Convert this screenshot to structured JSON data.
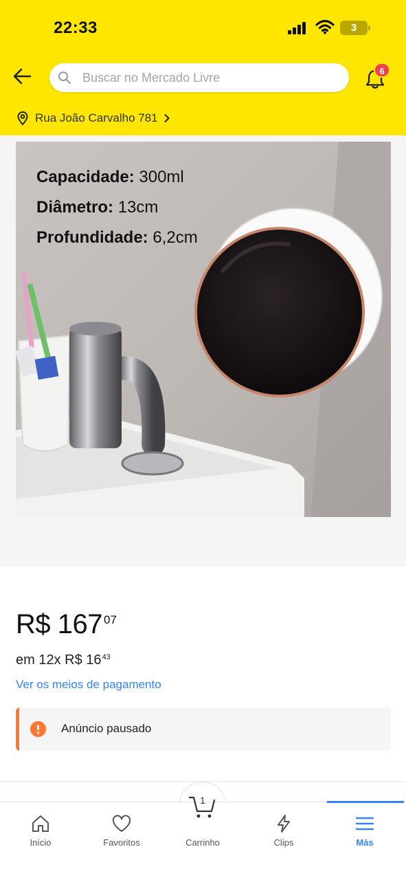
{
  "status_bar": {
    "time": "22:33",
    "battery": "3",
    "icons": [
      "signal-icon",
      "wifi-icon",
      "battery-icon"
    ]
  },
  "header": {
    "background": "#fee600",
    "search": {
      "placeholder": "Buscar no Mercado Livre"
    },
    "notifications": {
      "count": "6"
    },
    "location": "Rua João Carvalho 781"
  },
  "product_image": {
    "specs": [
      {
        "label": "Capacidade:",
        "value": " 300ml"
      },
      {
        "label": "Diâmetro:",
        "value": " 13cm"
      },
      {
        "label": "Profundidade:",
        "value": " 6,2cm"
      }
    ]
  },
  "price": {
    "currency": "R$",
    "integer": "167",
    "cents": "07",
    "installments_prefix": "em 12x R$ 16",
    "installments_cents": "43",
    "payment_link": "Ver os meios de pagamento"
  },
  "notice": {
    "text": "Anúncio pausado",
    "accent": "#ff7733"
  },
  "bottom_nav": {
    "items": [
      {
        "label": "Início",
        "icon": "home-icon"
      },
      {
        "label": "Favoritos",
        "icon": "heart-icon"
      },
      {
        "label": "Carrinho",
        "icon": "cart-icon",
        "count": "1"
      },
      {
        "label": "Clips",
        "icon": "lightning-icon"
      },
      {
        "label": "Más",
        "icon": "menu-icon",
        "active": true
      }
    ],
    "active_color": "#3483fa"
  }
}
